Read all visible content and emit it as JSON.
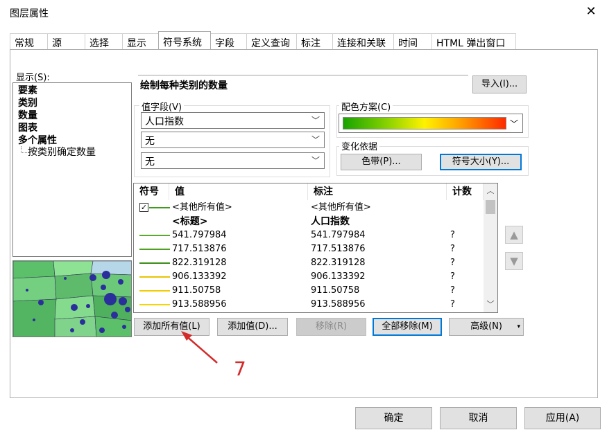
{
  "window": {
    "title": "图层属性",
    "close_glyph": "✕"
  },
  "tabs": [
    {
      "label": "常规"
    },
    {
      "label": "源"
    },
    {
      "label": "选择"
    },
    {
      "label": "显示"
    },
    {
      "label": "符号系统",
      "active": true
    },
    {
      "label": "字段"
    },
    {
      "label": "定义查询"
    },
    {
      "label": "标注"
    },
    {
      "label": "连接和关联"
    },
    {
      "label": "时间"
    },
    {
      "label": "HTML 弹出窗口"
    }
  ],
  "show": {
    "label": "显示(S):",
    "items": [
      "要素",
      "类别",
      "数量",
      "图表",
      "多个属性"
    ],
    "sub_item": "按类别确定数量"
  },
  "description": "绘制每种类别的数量",
  "import_button": "导入(I)...",
  "value_field": {
    "label": "值字段(V)",
    "selects": [
      "人口指数",
      "无",
      "无"
    ]
  },
  "color_scheme": {
    "label": "配色方案(C)"
  },
  "variation": {
    "label": "变化依据",
    "band_button": "色带(P)...",
    "size_button": "符号大小(Y)..."
  },
  "table": {
    "headers": {
      "symbol": "符号",
      "value": "值",
      "label": "标注",
      "count": "计数"
    },
    "rows": [
      {
        "value": "<其他所有值>",
        "label": "<其他所有值>",
        "count": "",
        "color": "#3f9a1e",
        "checked": true,
        "bold": false
      },
      {
        "value": "<标题>",
        "label": "人口指数",
        "count": "",
        "color": "",
        "checked": false,
        "bold": true
      },
      {
        "value": "541.797984",
        "label": "541.797984",
        "count": "?",
        "color": "#5aa92a",
        "checked": false,
        "bold": false
      },
      {
        "value": "717.513876",
        "label": "717.513876",
        "count": "?",
        "color": "#4e9f22",
        "checked": false,
        "bold": false
      },
      {
        "value": "822.319128",
        "label": "822.319128",
        "count": "?",
        "color": "#3c8d1a",
        "checked": false,
        "bold": false
      },
      {
        "value": "906.133392",
        "label": "906.133392",
        "count": "?",
        "color": "#e8c400",
        "checked": false,
        "bold": false
      },
      {
        "value": "911.50758",
        "label": "911.50758",
        "count": "?",
        "color": "#f0cc00",
        "checked": false,
        "bold": false
      },
      {
        "value": "913.588956",
        "label": "913.588956",
        "count": "?",
        "color": "#f5d400",
        "checked": false,
        "bold": false
      }
    ]
  },
  "buttons": {
    "add_all": "添加所有值(L)",
    "add_values": "添加值(D)...",
    "remove": "移除(R)",
    "remove_all": "全部移除(M)",
    "advanced": "高级(N)",
    "ok": "确定",
    "cancel": "取消",
    "apply": "应用(A)"
  },
  "annotation": {
    "number": "7",
    "color": "#d42a2a"
  }
}
